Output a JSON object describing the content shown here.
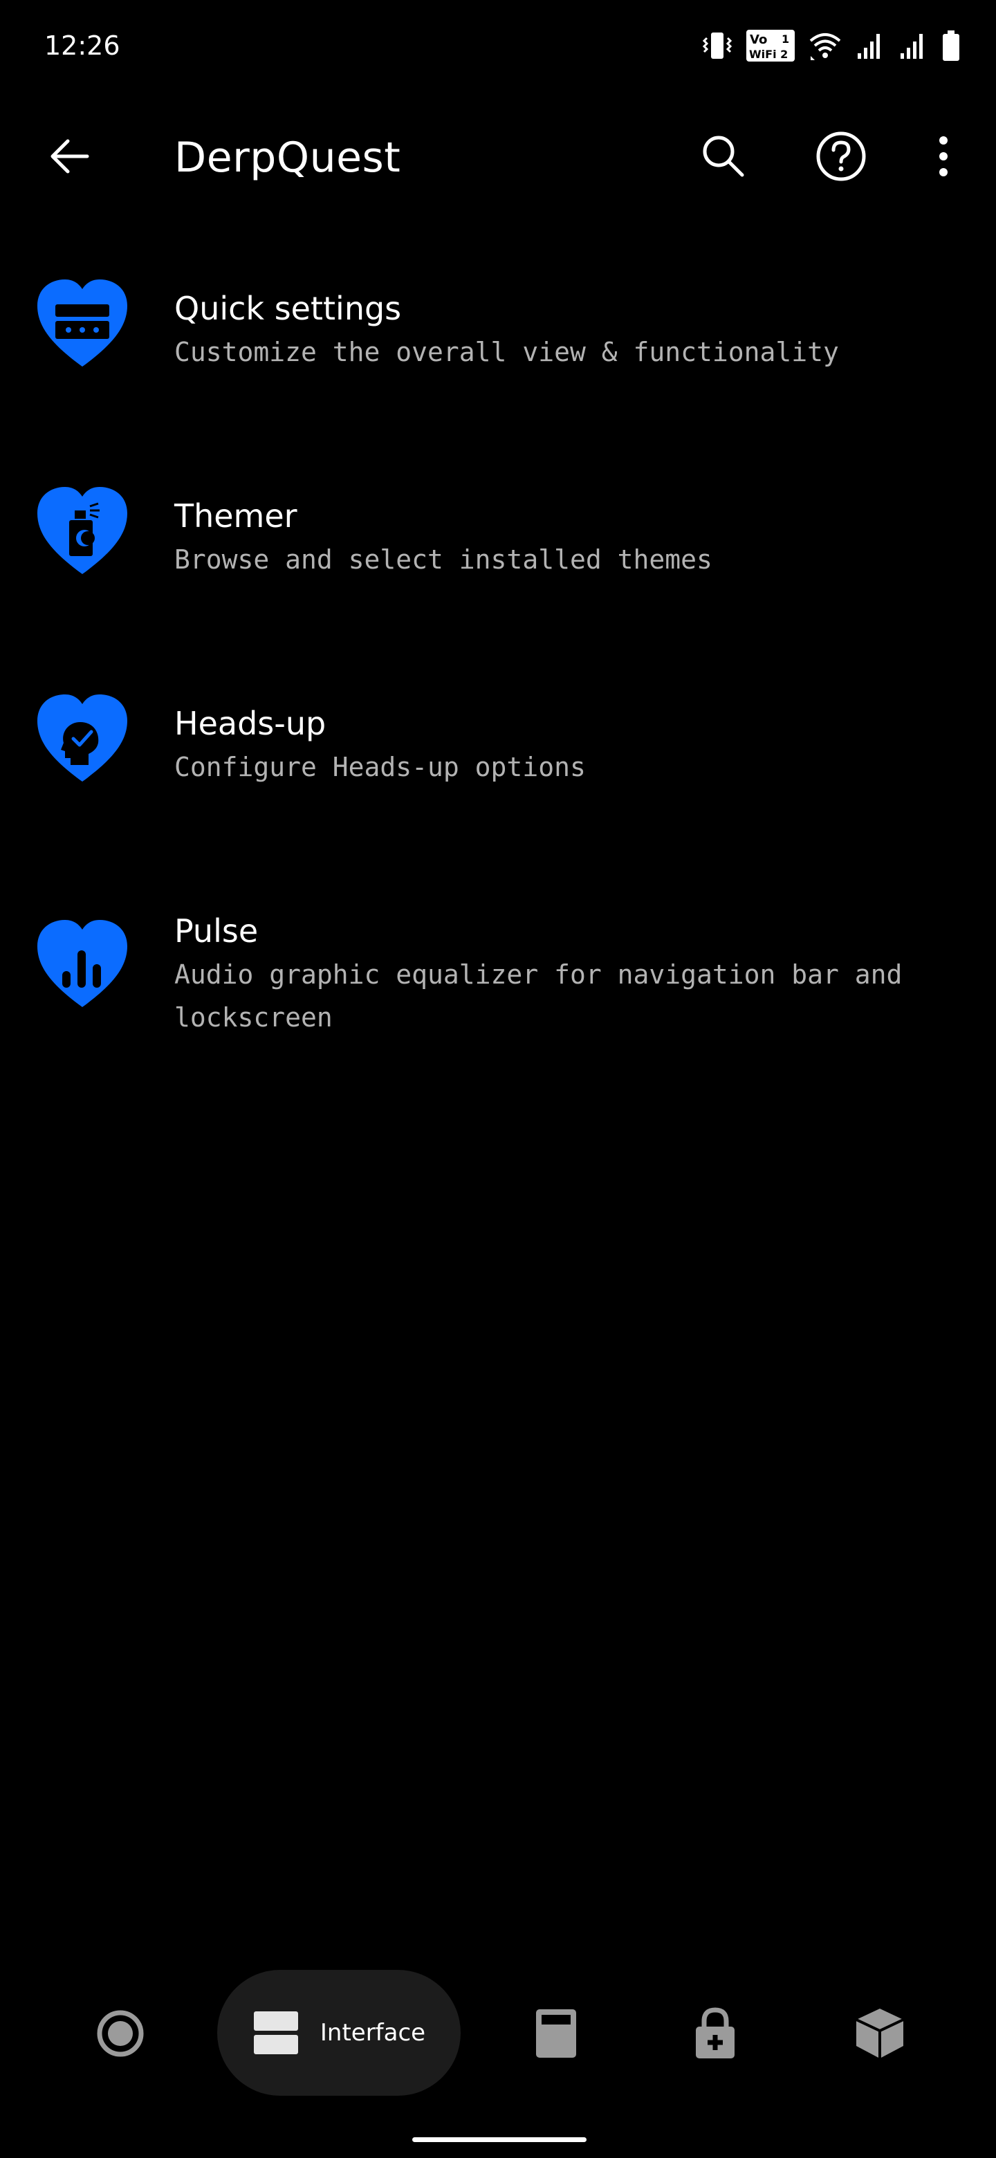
{
  "status_bar": {
    "time": "12:26",
    "vowifi_label_top": "Vo",
    "vowifi_label_bottom": "WiFi 2",
    "vowifi_sim": "1"
  },
  "top_bar": {
    "title": "DerpQuest"
  },
  "colors": {
    "accent": "#0b6cff",
    "background": "#000000",
    "nav_pill": "#1c1c1c",
    "nav_icon": "#9b9b9b"
  },
  "items": [
    {
      "title": "Quick settings",
      "subtitle": "Customize the overall view & functionality",
      "icon": "quick-settings-heart-icon"
    },
    {
      "title": "Themer",
      "subtitle": "Browse and select installed themes",
      "icon": "themer-heart-icon"
    },
    {
      "title": "Heads-up",
      "subtitle": "Configure Heads-up options",
      "icon": "heads-up-heart-icon"
    },
    {
      "title": "Pulse",
      "subtitle": "Audio graphic equalizer for navigation bar and lockscreen",
      "icon": "pulse-heart-icon"
    }
  ],
  "bottom_nav": {
    "selected_label": "Interface",
    "icons": [
      "circle-target-icon",
      "interface-icon",
      "calculator-icon",
      "lock-plus-icon",
      "cube-icon"
    ]
  }
}
